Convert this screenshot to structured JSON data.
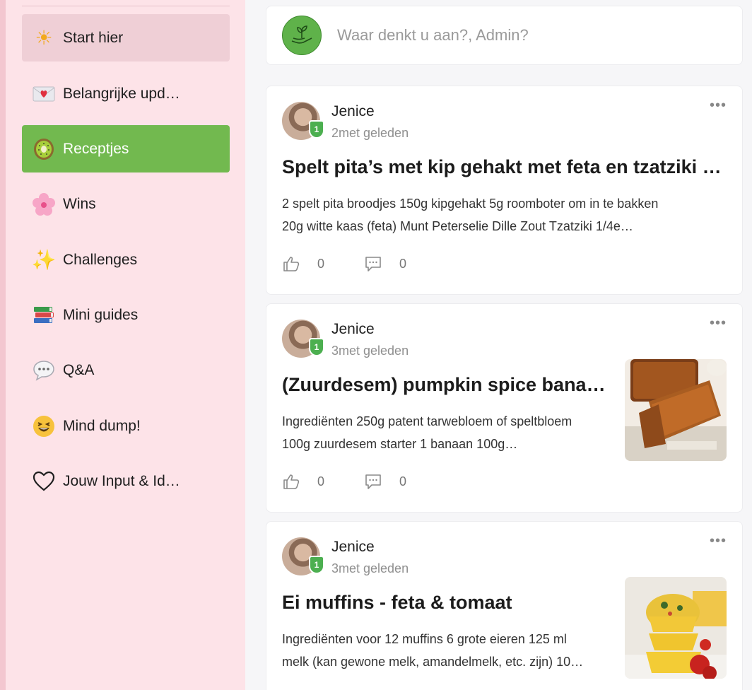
{
  "sidebar": {
    "items": [
      {
        "label": "Start hier",
        "icon": "sun-icon",
        "emoji": "☀"
      },
      {
        "label": "Belangrijke upd…",
        "icon": "envelope-heart-icon",
        "emoji": "💌"
      },
      {
        "label": "Receptjes",
        "icon": "kiwi-icon",
        "emoji": "🥝"
      },
      {
        "label": "Wins",
        "icon": "flower-icon",
        "emoji": "🌸"
      },
      {
        "label": "Challenges",
        "icon": "sparkles-icon",
        "emoji": "✨"
      },
      {
        "label": "Mini guides",
        "icon": "books-icon",
        "emoji": "📚"
      },
      {
        "label": "Q&A",
        "icon": "speech-bubble-icon",
        "emoji": "💬"
      },
      {
        "label": "Mind dump!",
        "icon": "grinning-face-icon",
        "emoji": "😆"
      },
      {
        "label": "Jouw Input & Id…",
        "icon": "heart-outline-icon",
        "emoji": "♡"
      }
    ],
    "active_green_color": "#72b94f",
    "background": "#fde3e8"
  },
  "composer": {
    "placeholder": "Waar denkt u aan?, Admin?"
  },
  "posts": [
    {
      "author": "Jenice",
      "badge": "1",
      "time": "2met geleden",
      "title": "Spelt pita’s met kip gehakt met feta en tzatziki …",
      "excerpt_line1": "2 spelt pita broodjes 150g kipgehakt 5g roomboter om in te bakken",
      "excerpt_line2": "20g witte kaas (feta) Munt Peterselie Dille Zout Tzatziki 1/4e…",
      "likes": "0",
      "comments": "0"
    },
    {
      "author": "Jenice",
      "badge": "1",
      "time": "3met geleden",
      "title": "(Zuurdesem) pumpkin spice banan…",
      "excerpt_line1": "Ingrediënten 250g patent tarwebloem of speltbloem",
      "excerpt_line2": "100g zuurdesem starter 1 banaan 100g…",
      "likes": "0",
      "comments": "0"
    },
    {
      "author": "Jenice",
      "badge": "1",
      "time": "3met geleden",
      "title": "Ei muffins - feta & tomaat",
      "excerpt_line1": "Ingrediënten voor 12 muffins 6 grote eieren 125 ml",
      "excerpt_line2": "melk (kan gewone melk, amandelmelk, etc. zijn) 10…"
    }
  ]
}
